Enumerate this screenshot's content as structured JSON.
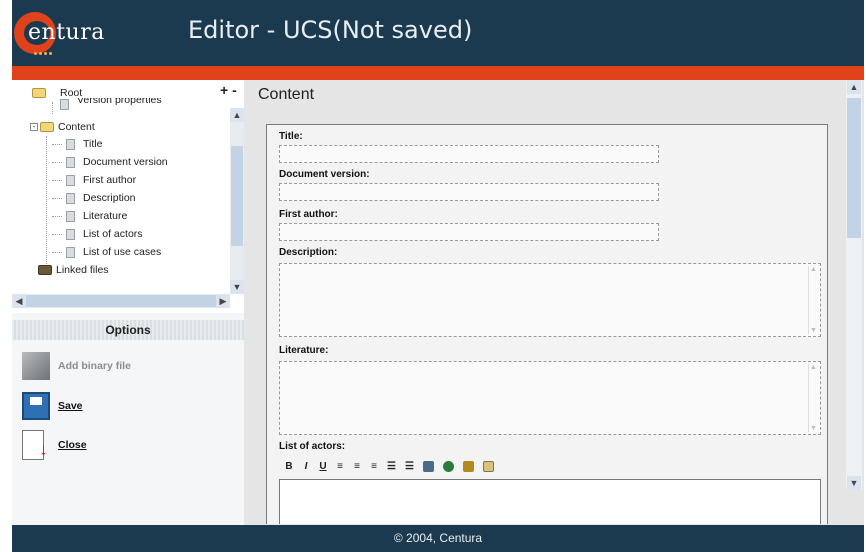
{
  "app": {
    "logo_text": "entura",
    "title": "Editor - UCS(Not saved)"
  },
  "tree": {
    "plus_minus": "+ -",
    "items": [
      {
        "label": "Root"
      },
      {
        "label": "Version properties"
      },
      {
        "label": "Content"
      },
      {
        "label": "Title"
      },
      {
        "label": "Document version"
      },
      {
        "label": "First author"
      },
      {
        "label": "Description"
      },
      {
        "label": "Literature"
      },
      {
        "label": "List of actors"
      },
      {
        "label": "List of use cases"
      },
      {
        "label": "Linked files"
      }
    ]
  },
  "options": {
    "heading": "Options",
    "add_binary": "Add binary file",
    "save": "Save",
    "close": "Close"
  },
  "main": {
    "heading": "Content",
    "fields": {
      "title": "Title:",
      "doc_version": "Document version:",
      "first_author": "First author:",
      "description": "Description:",
      "literature": "Literature:",
      "actors": "List of actors:"
    },
    "toolbar": {
      "bold": "B",
      "italic": "I",
      "underline": "U",
      "align_left": "≡",
      "align_center": "≡",
      "align_right": "≡",
      "ordered_list": "☰",
      "unordered_list": "☰"
    }
  },
  "footer": {
    "copyright": "© 2004, Centura"
  },
  "colors": {
    "header": "#1c3a4f",
    "accent": "#e0431c",
    "scrollbar": "#c3d3e6"
  }
}
